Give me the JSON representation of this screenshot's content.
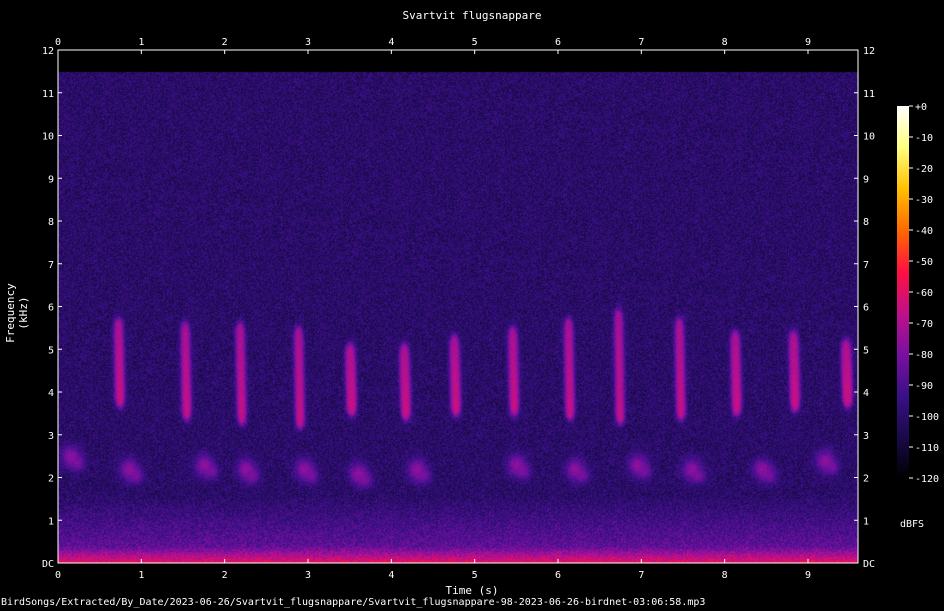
{
  "chart_data": {
    "type": "heatmap",
    "title": "Svartvit flugsnappare",
    "xlabel": "Time (s)",
    "ylabel": "Frequency (kHz)",
    "xlim": [
      0,
      9.6
    ],
    "ylim": [
      0,
      12
    ],
    "x_ticks": [
      "0",
      "1",
      "2",
      "3",
      "4",
      "5",
      "6",
      "7",
      "8",
      "9"
    ],
    "y_ticks": [
      "DC",
      "1",
      "2",
      "3",
      "4",
      "5",
      "6",
      "7",
      "8",
      "9",
      "10",
      "11",
      "12"
    ],
    "colorbar": {
      "label": "dBFS",
      "range": [
        -120,
        0
      ],
      "ticks": [
        "+0",
        "-10",
        "-20",
        "-30",
        "-40",
        "-50",
        "-60",
        "-70",
        "-80",
        "-90",
        "-100",
        "-110",
        "-120"
      ],
      "colors": [
        "#000000",
        "#1a0a4a",
        "#3a1088",
        "#7a10a0",
        "#c0108a",
        "#ff1040",
        "#ff6a00",
        "#ffc000",
        "#ffff80",
        "#ffffff"
      ]
    },
    "background_level_dbfs": -100,
    "syllables": [
      {
        "t": 0.72,
        "f_low": 3.8,
        "f_high": 5.6
      },
      {
        "t": 1.52,
        "f_low": 3.5,
        "f_high": 5.5
      },
      {
        "t": 2.18,
        "f_low": 3.4,
        "f_high": 5.5
      },
      {
        "t": 2.88,
        "f_low": 3.3,
        "f_high": 5.4
      },
      {
        "t": 3.5,
        "f_low": 3.6,
        "f_high": 5.0
      },
      {
        "t": 4.15,
        "f_low": 3.5,
        "f_high": 5.0
      },
      {
        "t": 4.75,
        "f_low": 3.6,
        "f_high": 5.2
      },
      {
        "t": 5.45,
        "f_low": 3.6,
        "f_high": 5.4
      },
      {
        "t": 6.12,
        "f_low": 3.5,
        "f_high": 5.6
      },
      {
        "t": 6.72,
        "f_low": 3.4,
        "f_high": 5.8
      },
      {
        "t": 7.45,
        "f_low": 3.5,
        "f_high": 5.6
      },
      {
        "t": 8.12,
        "f_low": 3.6,
        "f_high": 5.3
      },
      {
        "t": 8.82,
        "f_low": 3.7,
        "f_high": 5.3
      },
      {
        "t": 9.45,
        "f_low": 3.8,
        "f_high": 5.1
      }
    ],
    "low_band_blobs": [
      {
        "t": 0.15,
        "f": 2.5
      },
      {
        "t": 0.85,
        "f": 2.2
      },
      {
        "t": 1.75,
        "f": 2.3
      },
      {
        "t": 2.25,
        "f": 2.2
      },
      {
        "t": 2.95,
        "f": 2.2
      },
      {
        "t": 3.6,
        "f": 2.1
      },
      {
        "t": 4.3,
        "f": 2.2
      },
      {
        "t": 5.5,
        "f": 2.3
      },
      {
        "t": 6.2,
        "f": 2.2
      },
      {
        "t": 6.95,
        "f": 2.3
      },
      {
        "t": 7.6,
        "f": 2.2
      },
      {
        "t": 8.45,
        "f": 2.2
      },
      {
        "t": 9.2,
        "f": 2.4
      }
    ],
    "noise_floor_top_khz": 11.5
  },
  "footer": {
    "filepath": "BirdSongs/Extracted/By_Date/2023-06-26/Svartvit_flugsnappare/Svartvit_flugsnappare-98-2023-06-26-birdnet-03:06:58.mp3"
  }
}
